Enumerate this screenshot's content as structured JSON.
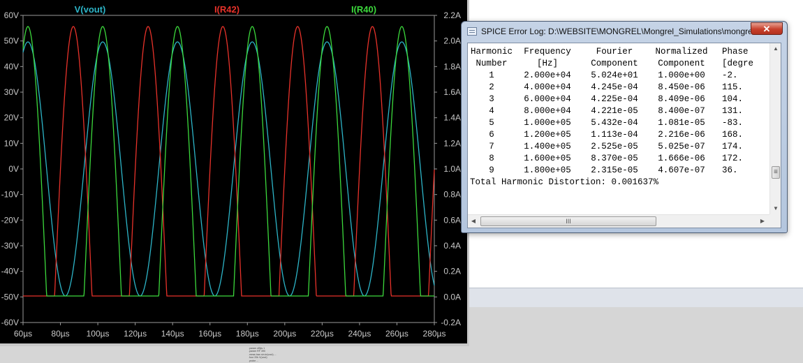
{
  "plot": {
    "traces": [
      {
        "label": "V(vout)",
        "color": "#2db5c8"
      },
      {
        "label": "I(R42)",
        "color": "#e8322a"
      },
      {
        "label": "I(R40)",
        "color": "#3cd93c"
      }
    ],
    "left_axis_ticks": [
      "60V",
      "50V",
      "40V",
      "30V",
      "20V",
      "10V",
      "0V",
      "-10V",
      "-20V",
      "-30V",
      "-40V",
      "-50V",
      "-60V"
    ],
    "right_axis_ticks": [
      "2.2A",
      "2.0A",
      "1.8A",
      "1.6A",
      "1.4A",
      "1.2A",
      "1.0A",
      "0.8A",
      "0.6A",
      "0.4A",
      "0.2A",
      "0.0A",
      "-0.2A"
    ],
    "bottom_axis_ticks": [
      "60µs",
      "80µs",
      "100µs",
      "120µs",
      "140µs",
      "160µs",
      "180µs",
      "200µs",
      "220µs",
      "240µs",
      "260µs",
      "280µs"
    ],
    "colors": {
      "background": "#000000",
      "axis_text": "#c8c8c8"
    }
  },
  "log": {
    "title": "SPICE Error Log: D:\\WEBSITE\\MONGREL\\Mongrel_Simulations\\mongrel...",
    "close_glyph": "✕",
    "header1": {
      "num": "Harmonic",
      "freq": "Frequency",
      "four": "Fourier",
      "norm": "Normalized",
      "phase": "Phase"
    },
    "header2": {
      "num": "Number",
      "freq": "[Hz]",
      "four": "Component",
      "norm": "Component",
      "phase": "[degre"
    },
    "rows": [
      {
        "num": "1",
        "freq": "2.000e+04",
        "four": "5.024e+01",
        "norm": "1.000e+00",
        "phase": "-2."
      },
      {
        "num": "2",
        "freq": "4.000e+04",
        "four": "4.245e-04",
        "norm": "8.450e-06",
        "phase": "115."
      },
      {
        "num": "3",
        "freq": "6.000e+04",
        "four": "4.225e-04",
        "norm": "8.409e-06",
        "phase": "104."
      },
      {
        "num": "4",
        "freq": "8.000e+04",
        "four": "4.221e-05",
        "norm": "8.400e-07",
        "phase": "131."
      },
      {
        "num": "5",
        "freq": "1.000e+05",
        "four": "5.432e-04",
        "norm": "1.081e-05",
        "phase": "-83."
      },
      {
        "num": "6",
        "freq": "1.200e+05",
        "four": "1.113e-04",
        "norm": "2.216e-06",
        "phase": "168."
      },
      {
        "num": "7",
        "freq": "1.400e+05",
        "four": "2.525e-05",
        "norm": "5.025e-07",
        "phase": "174."
      },
      {
        "num": "8",
        "freq": "1.600e+05",
        "four": "8.370e-05",
        "norm": "1.666e-06",
        "phase": "172."
      },
      {
        "num": "9",
        "freq": "1.800e+05",
        "four": "2.315e-05",
        "norm": "4.607e-07",
        "phase": "36."
      }
    ],
    "thd": "Total Harmonic Distortion: 0.001637%",
    "hthumb_glyph": "III"
  },
  "netlist": {
    "lines": [
      ".param nBjts 1",
      ".param RF 390",
      ".meas tran sin.in(vout) ...",
      ".four 20k V(vout)",
      ".probe ..."
    ]
  }
}
